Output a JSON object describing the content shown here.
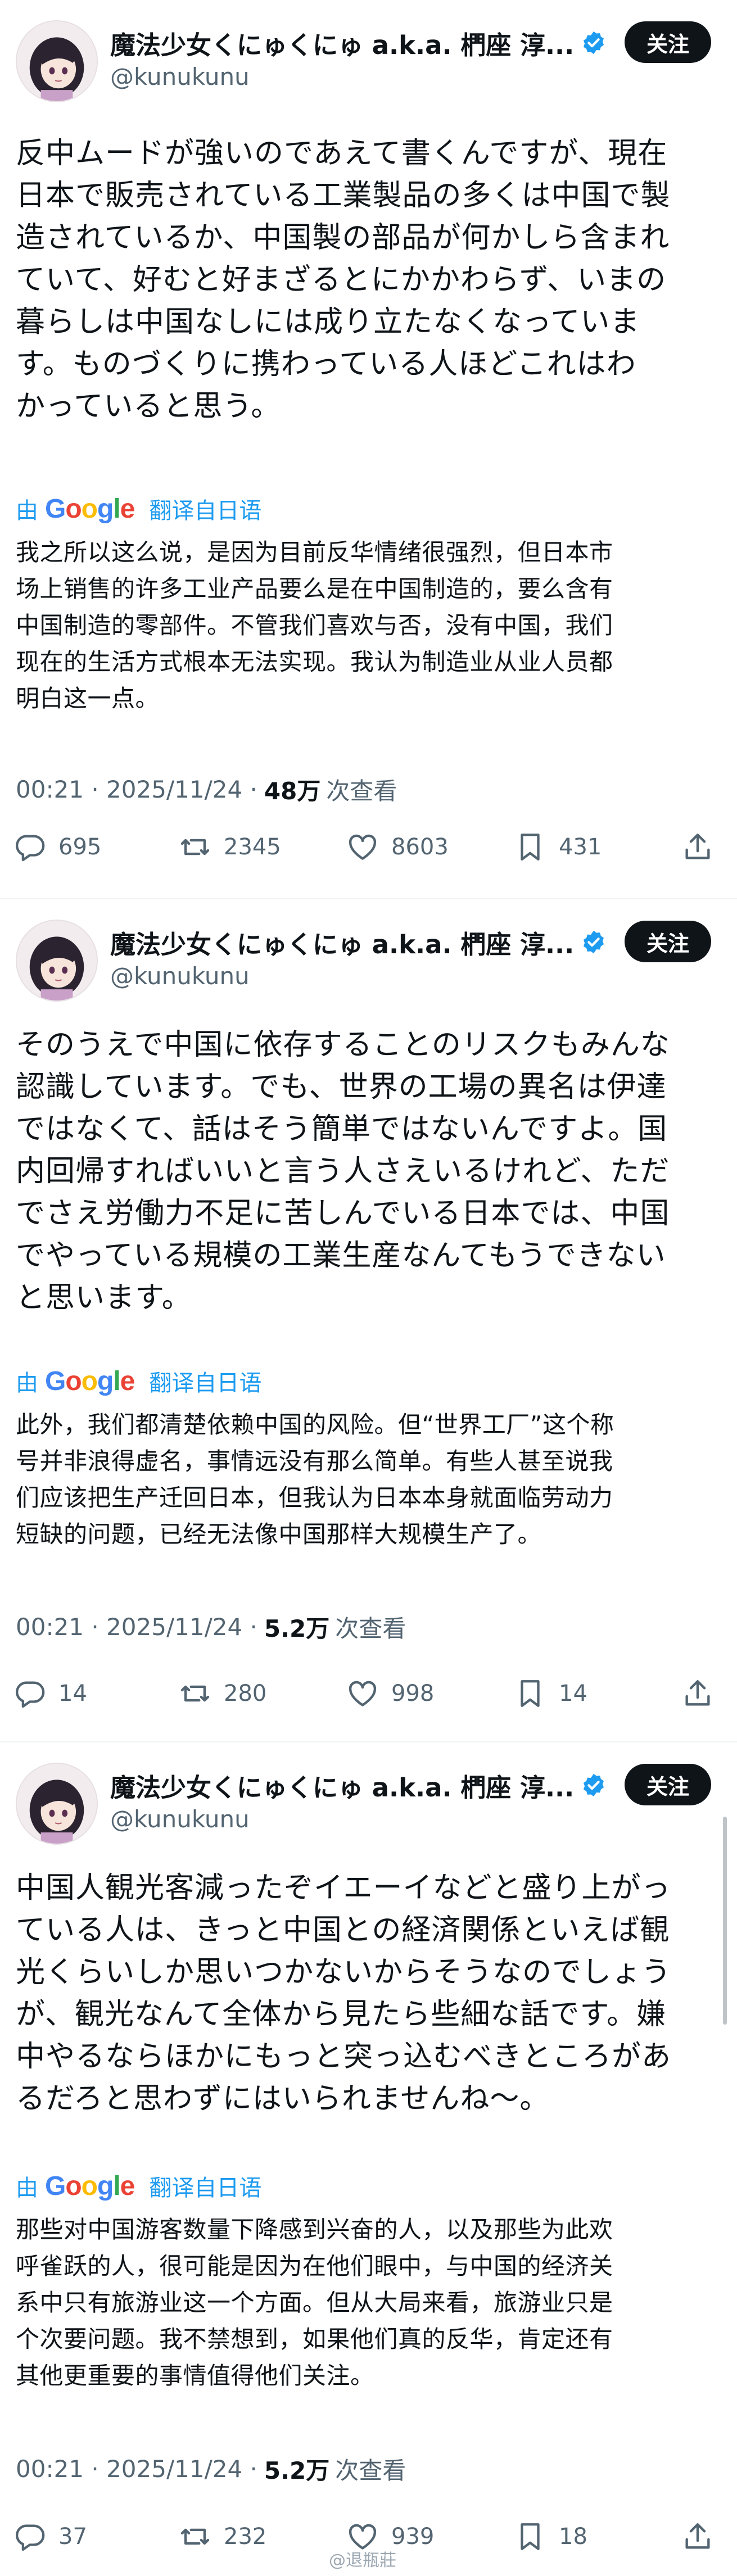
{
  "tweets": [
    {
      "name": "魔法少女くにゅくにゅ a.k.a. 椚座 淳...",
      "handle": "@kunukunu",
      "follow": "关注",
      "text": "反中ムードが強いのであえて書くんですが、現在\n日本で販売されている工業製品の多くは中国で製\n造されているか、中国製の部品が何かしら含まれ\nていて、好むと好まざるとにかかわらず、いまの\n暮らしは中国なしには成り立たなくなっていま\nす。ものづくりに携わっている人ほどこれはわ\nかっていると思う。",
      "translate_by": "由",
      "translate_brand": "Google",
      "translate_label": "翻译自日语",
      "translation": "我之所以这么说，是因为目前反华情绪很强烈，但日本市\n场上销售的许多工业产品要么是在中国制造的，要么含有\n中国制造的零部件。不管我们喜欢与否，没有中国，我们\n现在的生活方式根本无法实现。我认为制造业从业人员都\n明白这一点。",
      "time": "00:21 · 2025/11/24 · ",
      "views_count": "48万",
      "views_label": "次查看",
      "replies": "695",
      "retweets": "2345",
      "likes": "8603",
      "bookmarks": "431"
    },
    {
      "name": "魔法少女くにゅくにゅ a.k.a. 椚座 淳...",
      "handle": "@kunukunu",
      "follow": "关注",
      "text": "そのうえで中国に依存することのリスクもみんな\n認識しています。でも、世界の工場の異名は伊達\nではなくて、話はそう簡単ではないんですよ。国\n内回帰すればいいと言う人さえいるけれど、ただ\nでさえ労働力不足に苦しんでいる日本では、中国\nでやっている規模の工業生産なんてもうできない\nと思います。",
      "translate_by": "由",
      "translate_brand": "Google",
      "translate_label": "翻译自日语",
      "translation": "此外，我们都清楚依赖中国的风险。但“世界工厂”这个称\n号并非浪得虚名，事情远没有那么简单。有些人甚至说我\n们应该把生产迁回日本，但我认为日本本身就面临劳动力\n短缺的问题，已经无法像中国那样大规模生产了。",
      "time": "00:21 · 2025/11/24 · ",
      "views_count": "5.2万",
      "views_label": "次查看",
      "replies": "14",
      "retweets": "280",
      "likes": "998",
      "bookmarks": "14"
    },
    {
      "name": "魔法少女くにゅくにゅ a.k.a. 椚座 淳...",
      "handle": "@kunukunu",
      "follow": "关注",
      "text": "中国人観光客減ったぞイエーイなどと盛り上がっ\nている人は、きっと中国との経済関係といえば観\n光くらいしか思いつかないからそうなのでしょう\nが、観光なんて全体から見たら些細な話です。嫌\n中やるならほかにもっと突っ込むべきところがあ\nるだろと思わずにはいられませんね〜。",
      "translate_by": "由",
      "translate_brand": "Google",
      "translate_label": "翻译自日语",
      "translation": "那些对中国游客数量下降感到兴奋的人，以及那些为此欢\n呼雀跃的人，很可能是因为在他们眼中，与中国的经济关\n系中只有旅游业这一个方面。但从大局来看，旅游业只是\n个次要问题。我不禁想到，如果他们真的反华，肯定还有\n其他更重要的事情值得他们关注。",
      "time": "00:21 · 2025/11/24 · ",
      "views_count": "5.2万",
      "views_label": "次查看",
      "replies": "37",
      "retweets": "232",
      "likes": "939",
      "bookmarks": "18"
    }
  ],
  "watermark": "@退瓶莊",
  "icons": [
    "verified-badge-icon",
    "reply-icon",
    "retweet-icon",
    "like-icon",
    "bookmark-icon",
    "share-icon"
  ],
  "colors": {
    "link": "#1d9bf0",
    "muted": "#536471",
    "text": "#0f1419",
    "button": "#0f1419"
  }
}
